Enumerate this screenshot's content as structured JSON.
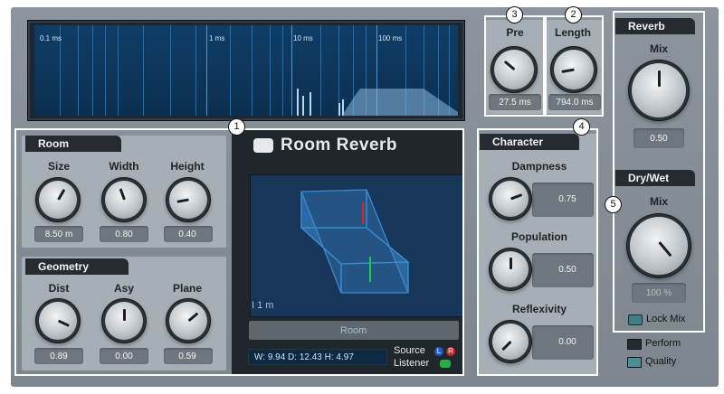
{
  "timeline": {
    "labels": [
      "0.1 ms",
      "1 ms",
      "10 ms",
      "100 ms"
    ]
  },
  "callouts": [
    "1",
    "2",
    "3",
    "4",
    "5"
  ],
  "pre": {
    "label": "Pre",
    "value": "27.5 ms"
  },
  "length": {
    "label": "Length",
    "value": "794.0 ms"
  },
  "reverb": {
    "title": "Reverb",
    "mix_label": "Mix",
    "mix_value": "0.50"
  },
  "drywet": {
    "title": "Dry/Wet",
    "mix_label": "Mix",
    "mix_value": "100 %",
    "lock_mix": "Lock Mix"
  },
  "room": {
    "title": "Room",
    "knobs": [
      {
        "label": "Size",
        "value": "8.50 m"
      },
      {
        "label": "Width",
        "value": "0.80"
      },
      {
        "label": "Height",
        "value": "0.40"
      }
    ]
  },
  "geometry": {
    "title": "Geometry",
    "knobs": [
      {
        "label": "Dist",
        "value": "0.89"
      },
      {
        "label": "Asy",
        "value": "0.00"
      },
      {
        "label": "Plane",
        "value": "0.59"
      }
    ]
  },
  "plugin": {
    "name": "Room Reverb",
    "scale_label": "I 1 m",
    "preset_button": "Room",
    "dims_text": "W:  9.94   D: 12.43  H:  4.97",
    "source_label": "Source",
    "listener_label": "Listener",
    "left_badge": "L",
    "right_badge": "R"
  },
  "character": {
    "title": "Character",
    "params": [
      {
        "label": "Dampness",
        "value": "0.75"
      },
      {
        "label": "Population",
        "value": "0.50"
      },
      {
        "label": "Reflexivity",
        "value": "0.00"
      }
    ]
  },
  "options": {
    "perform": "Perform",
    "quality": "Quality"
  },
  "colors": {
    "accent": "#2aa3c4",
    "highlight": "#ffffff",
    "panel": "#868f97"
  }
}
